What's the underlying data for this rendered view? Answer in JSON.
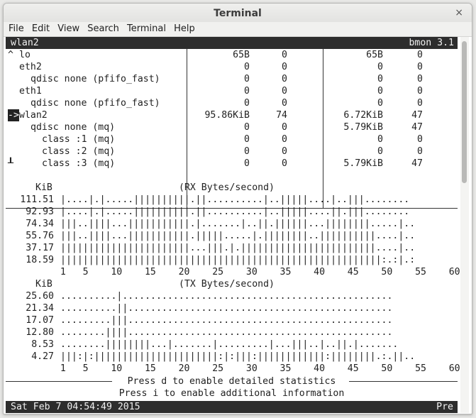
{
  "window": {
    "title": "Terminal",
    "close_glyph": "×"
  },
  "menu": [
    "File",
    "Edit",
    "View",
    "Search",
    "Terminal",
    "Help"
  ],
  "header": {
    "interface": "wlan2",
    "app": "bmon 3.1"
  },
  "interfaces": [
    {
      "marker": "^",
      "name": "lo",
      "indent": 0,
      "rx": "65B",
      "rxp": "0",
      "tx": "65B",
      "txp": "0"
    },
    {
      "marker": "",
      "name": "eth2",
      "indent": 0,
      "rx": "0",
      "rxp": "0",
      "tx": "0",
      "txp": "0"
    },
    {
      "marker": "",
      "name": "qdisc none (pfifo_fast)",
      "indent": 1,
      "rx": "0",
      "rxp": "0",
      "tx": "0",
      "txp": "0"
    },
    {
      "marker": "",
      "name": "eth1",
      "indent": 0,
      "rx": "0",
      "rxp": "0",
      "tx": "0",
      "txp": "0"
    },
    {
      "marker": "",
      "name": "qdisc none (pfifo_fast)",
      "indent": 1,
      "rx": "0",
      "rxp": "0",
      "tx": "0",
      "txp": "0"
    },
    {
      "marker": "->",
      "name": "wlan2",
      "indent": 0,
      "rx": "95.86KiB",
      "rxp": "74",
      "tx": "6.72KiB",
      "txp": "47"
    },
    {
      "marker": "",
      "name": "qdisc none (mq)",
      "indent": 1,
      "rx": "0",
      "rxp": "0",
      "tx": "5.79KiB",
      "txp": "47"
    },
    {
      "marker": "",
      "name": "class :1 (mq)",
      "indent": 2,
      "rx": "0",
      "rxp": "0",
      "tx": "0",
      "txp": "0"
    },
    {
      "marker": "",
      "name": "class :2 (mq)",
      "indent": 2,
      "rx": "0",
      "rxp": "0",
      "tx": "0",
      "txp": "0"
    },
    {
      "marker": "┸",
      "name": "class :3 (mq)",
      "indent": 2,
      "rx": "0",
      "rxp": "0",
      "tx": "5.79KiB",
      "txp": "47"
    }
  ],
  "rx_graph": {
    "unit": "KiB",
    "title": "(RX Bytes/second)",
    "rows": [
      {
        "label": "111.51",
        "pattern": "|....|.|.....||||||||||.||..........|..|||||....|..|||........"
      },
      {
        "label": "92.93",
        "pattern": "|....|.|.....||||||||||.||..........|..|||||....||.|||........"
      },
      {
        "label": "74.34",
        "pattern": "|||..||||...|||||||||||.|.......|..||.||||||...||||||||.....|.."
      },
      {
        "label": "55.76",
        "pattern": "|||..||||...|||||||||||.|||||.....|.||||||||..||||||||||....|.."
      },
      {
        "label": "37.17",
        "pattern": "|||||||||||||||||||||||...|||.|.||||||||||||||||||||||||....|.."
      },
      {
        "label": "18.59",
        "pattern": "|||||||||||||||||||||||||||||||||||||||||||||||||||||||||:.:|.:"
      }
    ],
    "axis": "  1   5    10    15    20    25    30    35    40    45    50    55    60"
  },
  "tx_graph": {
    "unit": "KiB",
    "title": "(TX Bytes/second)",
    "rows": [
      {
        "label": "25.60",
        "pattern": "..........|................................................"
      },
      {
        "label": "21.34",
        "pattern": "..........||..............................................."
      },
      {
        "label": "17.07",
        "pattern": ".........|||..............................................."
      },
      {
        "label": "12.80",
        "pattern": "........||||..............................................."
      },
      {
        "label": "8.53",
        "pattern": "........||||||||...|.......|.........|...|||..|..||.|......."
      },
      {
        "label": "4.27",
        "pattern": "|||:|:||||||||||||||||||||||:|:|||:||||||||||||:||||||||.:.||.."
      }
    ],
    "axis": "  1   5    10    15    20    25    30    35    40    45    50    55    60"
  },
  "hints": [
    "Press d to enable detailed statistics",
    "Press i to enable additional information"
  ],
  "status": {
    "datetime": "Sat Feb  7 04:54:49 2015",
    "right": "Pre"
  }
}
